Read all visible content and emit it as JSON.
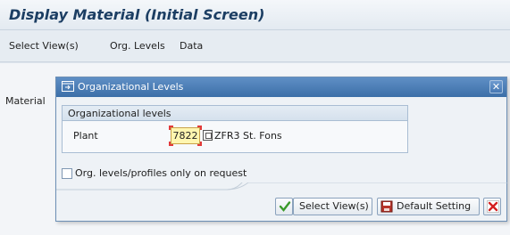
{
  "window": {
    "title": "Display Material (Initial Screen)"
  },
  "menu": {
    "items": [
      {
        "label": "Select View(s)"
      },
      {
        "label": "Org. Levels"
      },
      {
        "label": "Data"
      }
    ]
  },
  "background": {
    "material_label": "Material"
  },
  "dialog": {
    "title": "Organizational Levels",
    "group_title": "Organizational levels",
    "plant_label": "Plant",
    "plant_value": "7822",
    "plant_description": "ZFR3 St. Fons",
    "checkbox_label": "Org. levels/profiles only on request",
    "checkbox_checked": false,
    "buttons": {
      "select_views": "Select View(s)",
      "default_setting": "Default Setting"
    }
  },
  "colors": {
    "title_text": "#1c3e63",
    "dialog_header": "#3c6fa8",
    "input_required_bg": "#fff6b0",
    "check_green": "#3a9a2a",
    "cancel_red": "#d42020"
  }
}
